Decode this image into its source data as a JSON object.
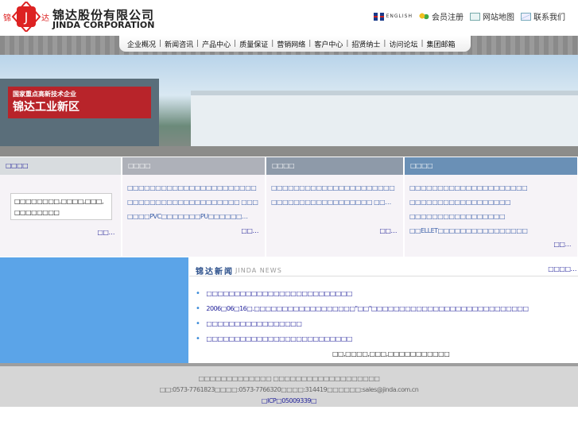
{
  "header": {
    "logo_cn": "锦达股份有限公司",
    "logo_en": "JINDA CORPORATION",
    "logo_badge": "锦 达",
    "links": [
      {
        "label": "ENGLISH",
        "icon": "uk-flag-icon"
      },
      {
        "label": "会员注册",
        "icon": "members-icon"
      },
      {
        "label": "网站地图",
        "icon": "sitemap-icon"
      },
      {
        "label": "联系我们",
        "icon": "mail-icon"
      }
    ]
  },
  "nav": [
    "企业概况",
    "新闻咨讯",
    "产品中心",
    "质量保证",
    "营销网络",
    "客户中心",
    "招贤纳士",
    "访问论坛",
    "集团邮箱"
  ],
  "banner": {
    "sign": "锦达工业新区",
    "sign_top": "国家重点高新技术企业"
  },
  "panels": [
    {
      "title": "□□□□",
      "body": "□□□□□□□□,□□□□,□□□,□□□□□□□□",
      "more": "□□…"
    },
    {
      "title": "□□□□",
      "body": "□□□□□□□□□□□□□□□□□□□□□□□□□□□□□□□□□□□□□□□□□□□ □□□□□□□PVC□□□□□□□PU□□□□□□…",
      "more": "□□…"
    },
    {
      "title": "□□□□",
      "body": "□□□□□□□□□□□□□□□□□□□□□□□□□□□□□□□□□□□□□□□□ □□…",
      "more": "□□…"
    },
    {
      "title": "□□□□",
      "lines": [
        "□□□□□□□□□□□□□□□□□□□□□",
        "□□□□□□□□□□□□□□□□□□",
        "□□□□□□□□□□□□□□□□□",
        "□□ELLET□□□□□□□□□□□□□□□□"
      ],
      "more": "□□…"
    }
  ],
  "news": {
    "title": "锦达新闻",
    "title_en": "JINDA NEWS",
    "more": "□□□□…",
    "items": [
      "□□□□□□□□□□□□□□□□□□□□□□□□□□",
      "2006□06□16□.□□□□□□□□□□□□□□□□□□\"□□\"□□□□□□□□□□□□□□□□□□□□□□□□□□□□",
      "□□□□□□□□□□□□□□□□□",
      "□□□□□□□□□□□□□□□□□□□□□□□□□□"
    ],
    "tagline": "□□,□□□□,□□□,□□□□□□□□□□□"
  },
  "footer": {
    "line1": "□□□□□□□□□□□□□ □□□□□□□□□□□□□□□□□□□",
    "line2": "□□:0573-7761823□□□□:0573-7766320□□□□:314419□□□□□□:sales@jinda.com.cn",
    "icp": "□ICP□05009339□"
  }
}
